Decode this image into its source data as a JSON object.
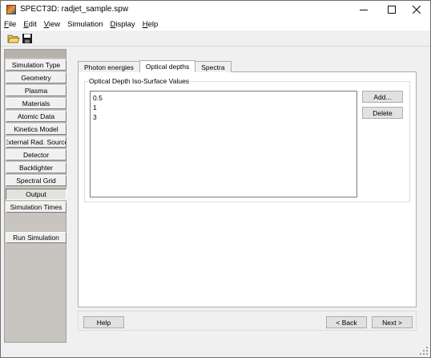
{
  "window": {
    "title": "SPECT3D:  radjet_sample.spw"
  },
  "menubar": {
    "items": [
      {
        "label": "File",
        "accel": "F",
        "rest": "ile"
      },
      {
        "label": "Edit",
        "accel": "E",
        "rest": "dit"
      },
      {
        "label": "View",
        "accel": "V",
        "rest": "iew"
      },
      {
        "label": "Simulation",
        "accel": "",
        "rest": "Simulation"
      },
      {
        "label": "Display",
        "accel": "D",
        "rest": "isplay"
      },
      {
        "label": "Help",
        "accel": "H",
        "rest": "elp"
      }
    ]
  },
  "toolbar": {
    "icons": [
      "open-folder-icon",
      "save-disk-icon"
    ]
  },
  "sidebar": {
    "items": [
      {
        "label": "Simulation Type",
        "active": false
      },
      {
        "label": "Geometry",
        "active": false
      },
      {
        "label": "Plasma",
        "active": false
      },
      {
        "label": "Materials",
        "active": false
      },
      {
        "label": "Atomic Data",
        "active": false
      },
      {
        "label": "Kinetics Model",
        "active": false
      },
      {
        "label": "External Rad. Source",
        "active": false
      },
      {
        "label": "Detector",
        "active": false
      },
      {
        "label": "Backlighter",
        "active": false
      },
      {
        "label": "Spectral Grid",
        "active": false
      },
      {
        "label": "Output",
        "active": true
      },
      {
        "label": "Simulation Times",
        "active": false
      }
    ],
    "run_label": "Run Simulation"
  },
  "tabs": [
    {
      "label": "Photon energies",
      "active": false
    },
    {
      "label": "Optical depths",
      "active": true
    },
    {
      "label": "Spectra",
      "active": false
    }
  ],
  "panel": {
    "group_label": "Optical Depth Iso-Surface Values",
    "values": [
      "0.5",
      "1",
      "3"
    ],
    "add_label": "Add...",
    "delete_label": "Delete"
  },
  "footer": {
    "help_label": "Help",
    "back_label": "< Back",
    "next_label": "Next >"
  },
  "colors": {
    "sidebar_bg": "#c8c4bf",
    "window_bg": "#f0f0f0",
    "button_bg": "#e1e1e1"
  }
}
